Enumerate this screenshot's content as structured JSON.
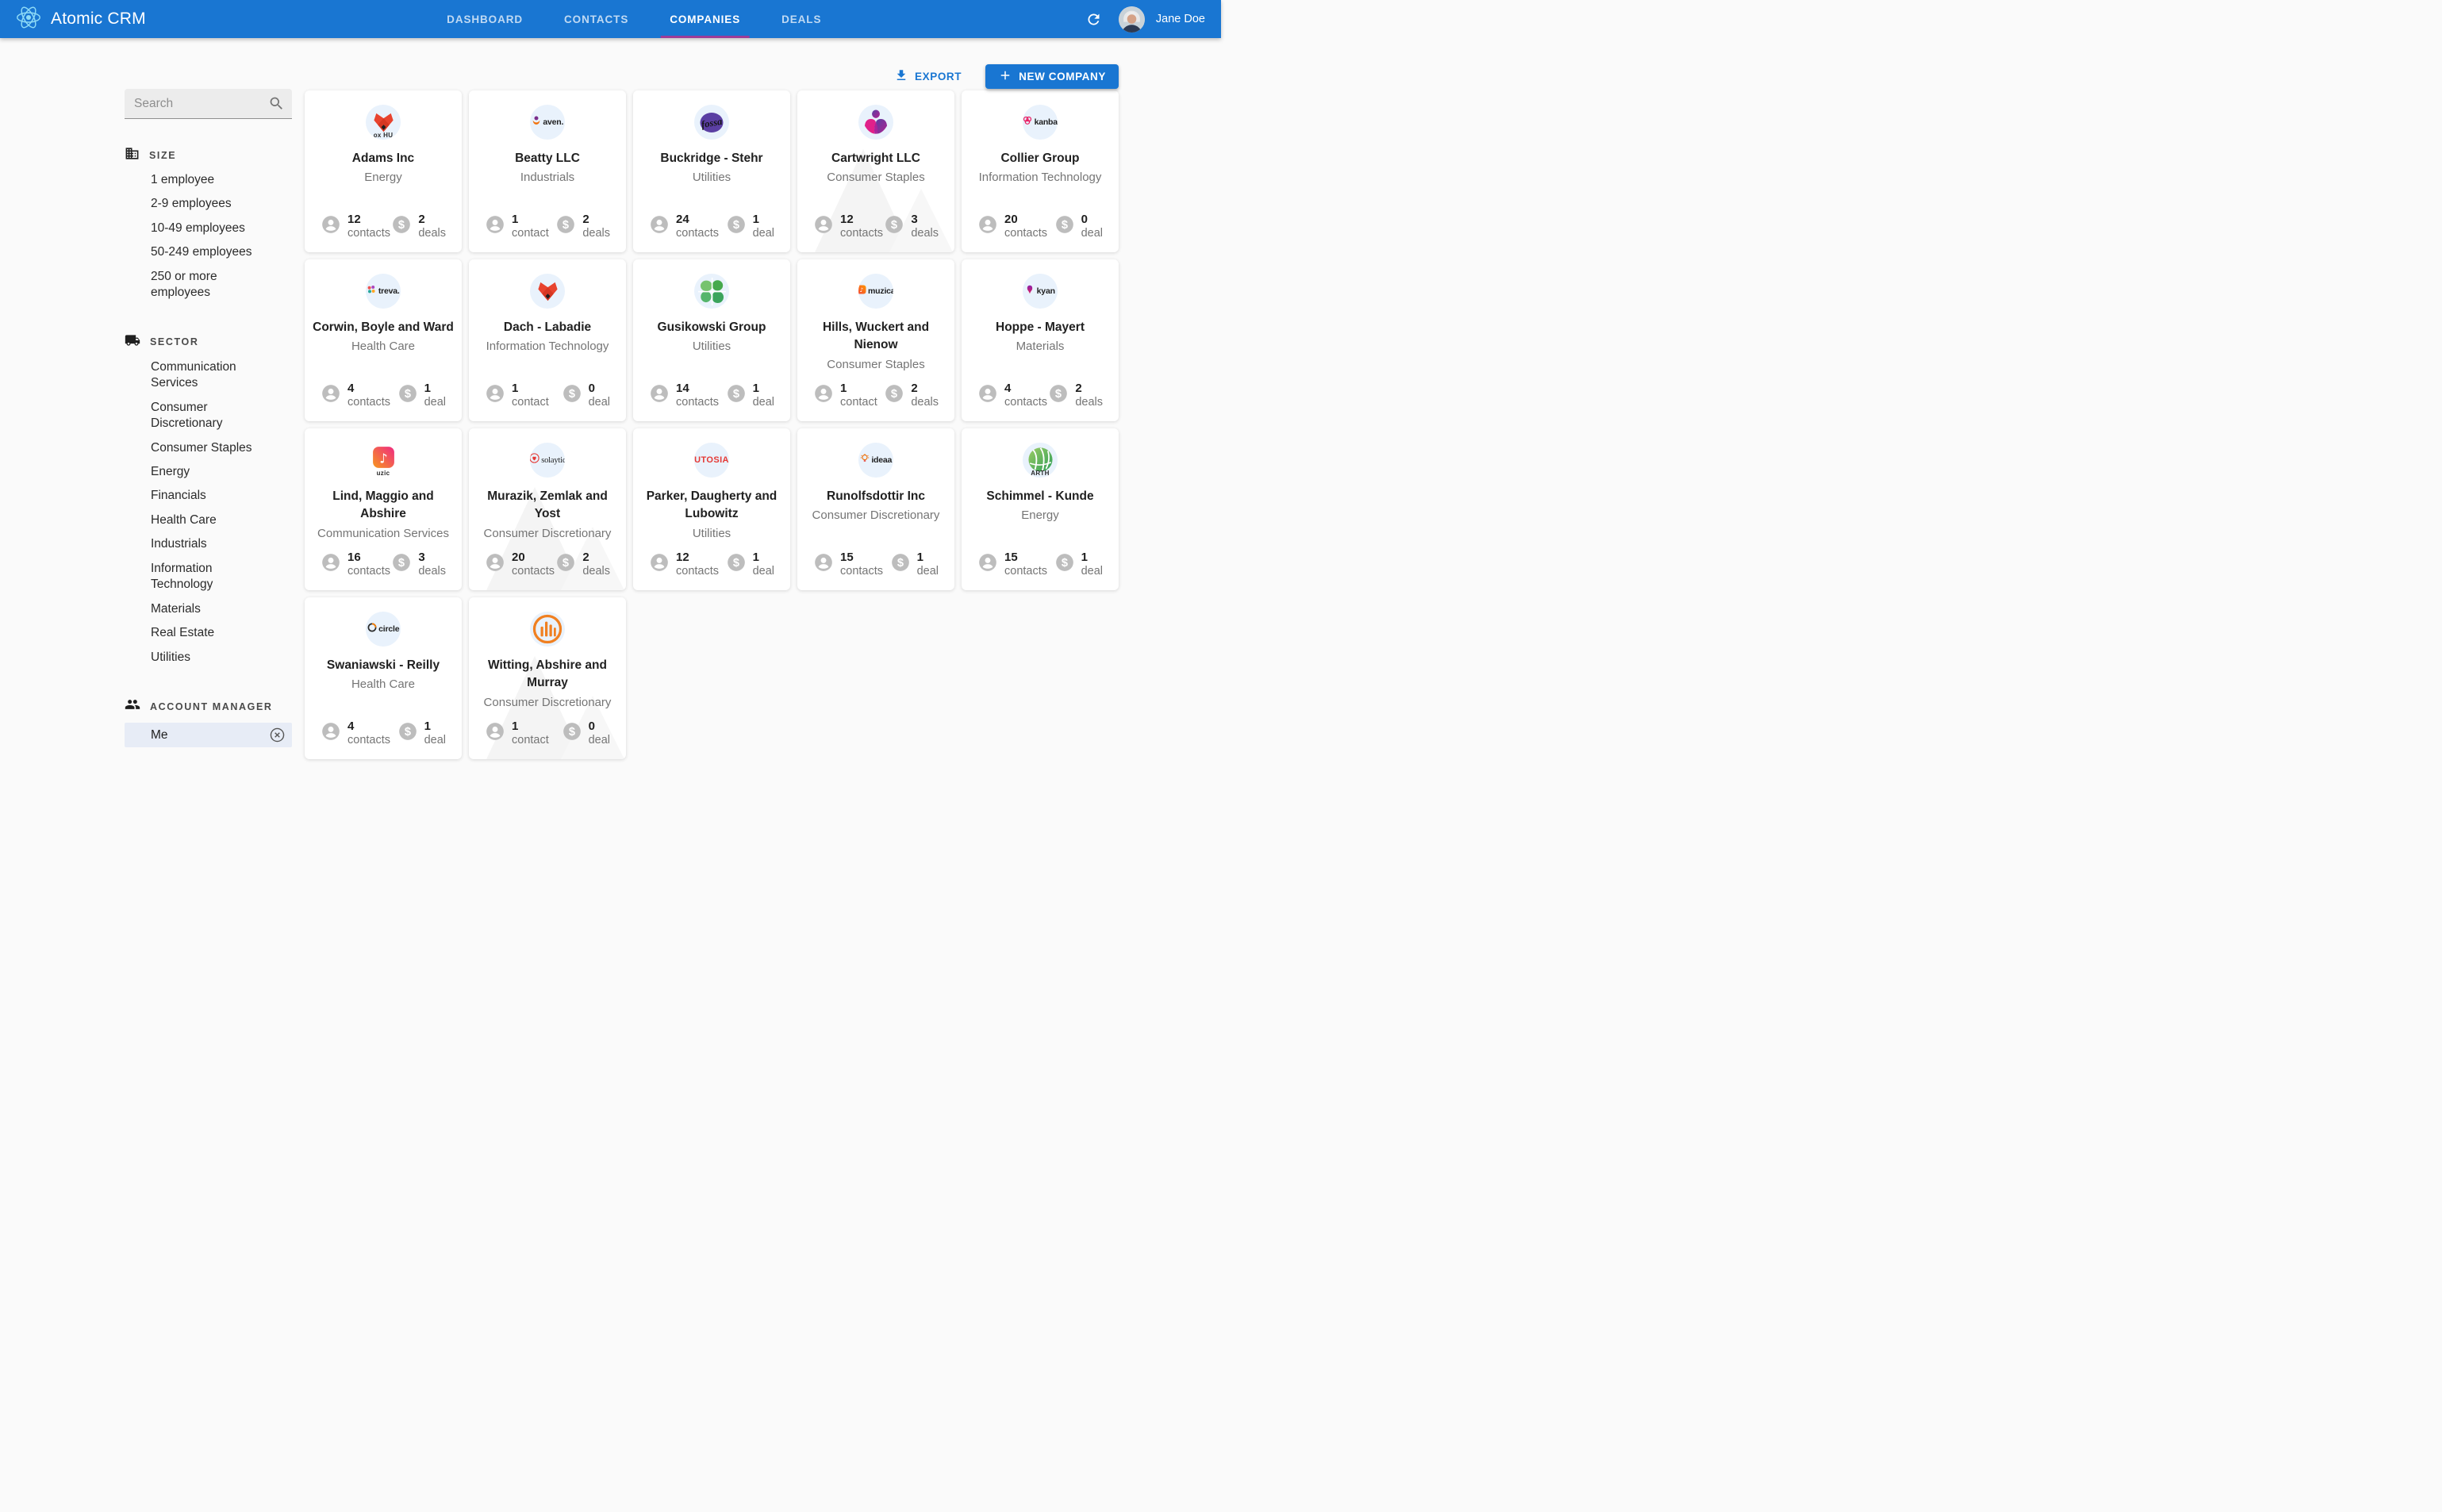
{
  "theme": {
    "primary": "#1976d2",
    "active_tab_underline": "#9c3c97",
    "page_bg": "#fafafa",
    "stat_icon_gray": "#bdbdbd"
  },
  "header": {
    "app_title": "Atomic CRM",
    "nav": [
      {
        "label": "DASHBOARD",
        "active": false
      },
      {
        "label": "CONTACTS",
        "active": false
      },
      {
        "label": "COMPANIES",
        "active": true
      },
      {
        "label": "DEALS",
        "active": false
      }
    ],
    "user_name": "Jane Doe"
  },
  "toolbar": {
    "export_label": "EXPORT",
    "new_company_label": "NEW COMPANY"
  },
  "sidebar": {
    "search_placeholder": "Search",
    "sections": [
      {
        "title": "SIZE",
        "icon": "building-icon",
        "items": [
          "1 employee",
          "2-9 employees",
          "10-49 employees",
          "50-249 employees",
          "250 or more employees"
        ]
      },
      {
        "title": "SECTOR",
        "icon": "truck-icon",
        "items": [
          "Communication Services",
          "Consumer Discretionary",
          "Consumer Staples",
          "Energy",
          "Financials",
          "Health Care",
          "Industrials",
          "Information Technology",
          "Materials",
          "Real Estate",
          "Utilities"
        ]
      },
      {
        "title": "ACCOUNT MANAGER",
        "icon": "people-icon",
        "items": [],
        "selected_filter": {
          "label": "Me",
          "clear_icon": "cancel-icon"
        }
      }
    ]
  },
  "companies": [
    {
      "name": "Adams Inc",
      "sector": "Energy",
      "contacts": "12",
      "contacts_label": "contacts",
      "deals": "2",
      "deals_label": "deals",
      "logo": {
        "kind": "fox",
        "caption": "ox HU"
      },
      "watermark": false
    },
    {
      "name": "Beatty LLC",
      "sector": "Industrials",
      "contacts": "1",
      "contacts_label": "contact",
      "deals": "2",
      "deals_label": "deals",
      "logo": {
        "kind": "mark-text",
        "mark": "flower",
        "text": "aven."
      },
      "watermark": false
    },
    {
      "name": "Buckridge - Stehr",
      "sector": "Utilities",
      "contacts": "24",
      "contacts_label": "contacts",
      "deals": "1",
      "deals_label": "deal",
      "logo": {
        "kind": "fossa",
        "text": "fossa"
      },
      "watermark": false
    },
    {
      "name": "Cartwright LLC",
      "sector": "Consumer Staples",
      "contacts": "12",
      "contacts_label": "contacts",
      "deals": "3",
      "deals_label": "deals",
      "logo": {
        "kind": "person"
      },
      "watermark": true
    },
    {
      "name": "Collier Group",
      "sector": "Information Technology",
      "contacts": "20",
      "contacts_label": "contacts",
      "deals": "0",
      "deals_label": "deal",
      "logo": {
        "kind": "mark-text",
        "mark": "knot",
        "text": "kanba"
      },
      "watermark": false
    },
    {
      "name": "Corwin, Boyle and Ward",
      "sector": "Health Care",
      "contacts": "4",
      "contacts_label": "contacts",
      "deals": "1",
      "deals_label": "deal",
      "logo": {
        "kind": "mark-text",
        "mark": "dots",
        "text": "treva."
      },
      "watermark": false
    },
    {
      "name": "Dach - Labadie",
      "sector": "Information Technology",
      "contacts": "1",
      "contacts_label": "contact",
      "deals": "0",
      "deals_label": "deal",
      "logo": {
        "kind": "fox",
        "caption": ""
      },
      "watermark": false
    },
    {
      "name": "Gusikowski Group",
      "sector": "Utilities",
      "contacts": "14",
      "contacts_label": "contacts",
      "deals": "1",
      "deals_label": "deal",
      "logo": {
        "kind": "clover"
      },
      "watermark": false
    },
    {
      "name": "Hills, Wuckert and Nienow",
      "sector": "Consumer Staples",
      "contacts": "1",
      "contacts_label": "contact",
      "deals": "2",
      "deals_label": "deals",
      "logo": {
        "kind": "mark-text",
        "mark": "square-note",
        "text": "muzica"
      },
      "watermark": false
    },
    {
      "name": "Hoppe - Mayert",
      "sector": "Materials",
      "contacts": "4",
      "contacts_label": "contacts",
      "deals": "2",
      "deals_label": "deals",
      "logo": {
        "kind": "mark-text",
        "mark": "bird",
        "text": "kyan"
      },
      "watermark": false
    },
    {
      "name": "Lind, Maggio and Abshire",
      "sector": "Communication Services",
      "contacts": "16",
      "contacts_label": "contacts",
      "deals": "3",
      "deals_label": "deals",
      "logo": {
        "kind": "note-big",
        "caption": "uzic",
        "bg": "#ffffff"
      },
      "watermark": false
    },
    {
      "name": "Murazik, Zemlak and Yost",
      "sector": "Consumer Discretionary",
      "contacts": "20",
      "contacts_label": "contacts",
      "deals": "2",
      "deals_label": "deals",
      "logo": {
        "kind": "mark-text",
        "mark": "heart-ring",
        "text": "solaytic",
        "serif": true
      },
      "watermark": true
    },
    {
      "name": "Parker, Daugherty and Lubowitz",
      "sector": "Utilities",
      "contacts": "12",
      "contacts_label": "contacts",
      "deals": "1",
      "deals_label": "deal",
      "logo": {
        "kind": "word",
        "text": "UTOSIA"
      },
      "watermark": false
    },
    {
      "name": "Runolfsdottir Inc",
      "sector": "Consumer Discretionary",
      "contacts": "15",
      "contacts_label": "contacts",
      "deals": "1",
      "deals_label": "deal",
      "logo": {
        "kind": "mark-text",
        "mark": "bulb",
        "text": "ideaa"
      },
      "watermark": false
    },
    {
      "name": "Schimmel - Kunde",
      "sector": "Energy",
      "contacts": "15",
      "contacts_label": "contacts",
      "deals": "1",
      "deals_label": "deal",
      "logo": {
        "kind": "globe",
        "caption": "ARTH"
      },
      "watermark": false
    },
    {
      "name": "Swaniawski - Reilly",
      "sector": "Health Care",
      "contacts": "4",
      "contacts_label": "contacts",
      "deals": "1",
      "deals_label": "deal",
      "logo": {
        "kind": "mark-text",
        "mark": "ring",
        "text": "circle"
      },
      "watermark": false
    },
    {
      "name": "Witting, Abshire and Murray",
      "sector": "Consumer Discretionary",
      "contacts": "1",
      "contacts_label": "contact",
      "deals": "0",
      "deals_label": "deal",
      "logo": {
        "kind": "bars"
      },
      "watermark": true
    }
  ]
}
